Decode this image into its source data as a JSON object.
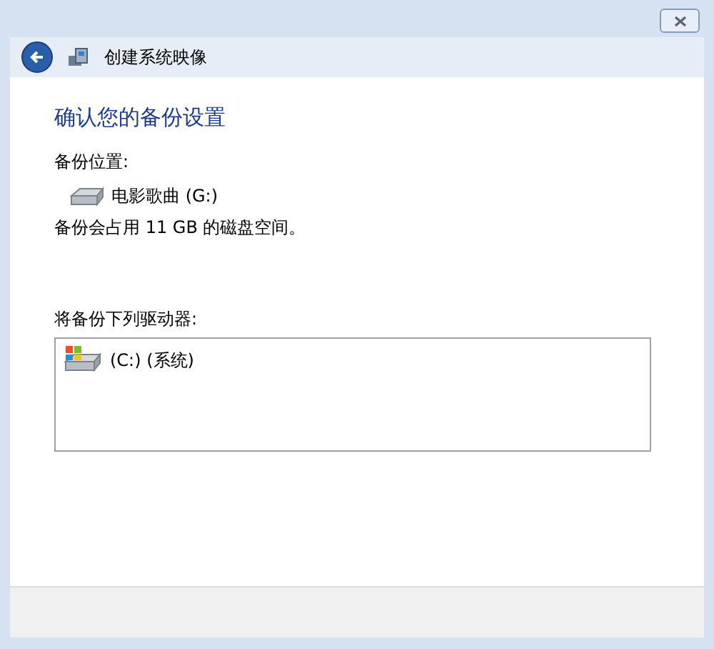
{
  "window": {
    "title": "创建系统映像"
  },
  "heading": "确认您的备份设置",
  "backup_location": {
    "label": "备份位置:",
    "drive": "电影歌曲 (G:)",
    "space_note": "备份会占用 11 GB 的磁盘空间。"
  },
  "drives": {
    "label": "将备份下列驱动器:",
    "items": [
      {
        "name": "(C:) (系统)",
        "kind": "system"
      }
    ]
  }
}
